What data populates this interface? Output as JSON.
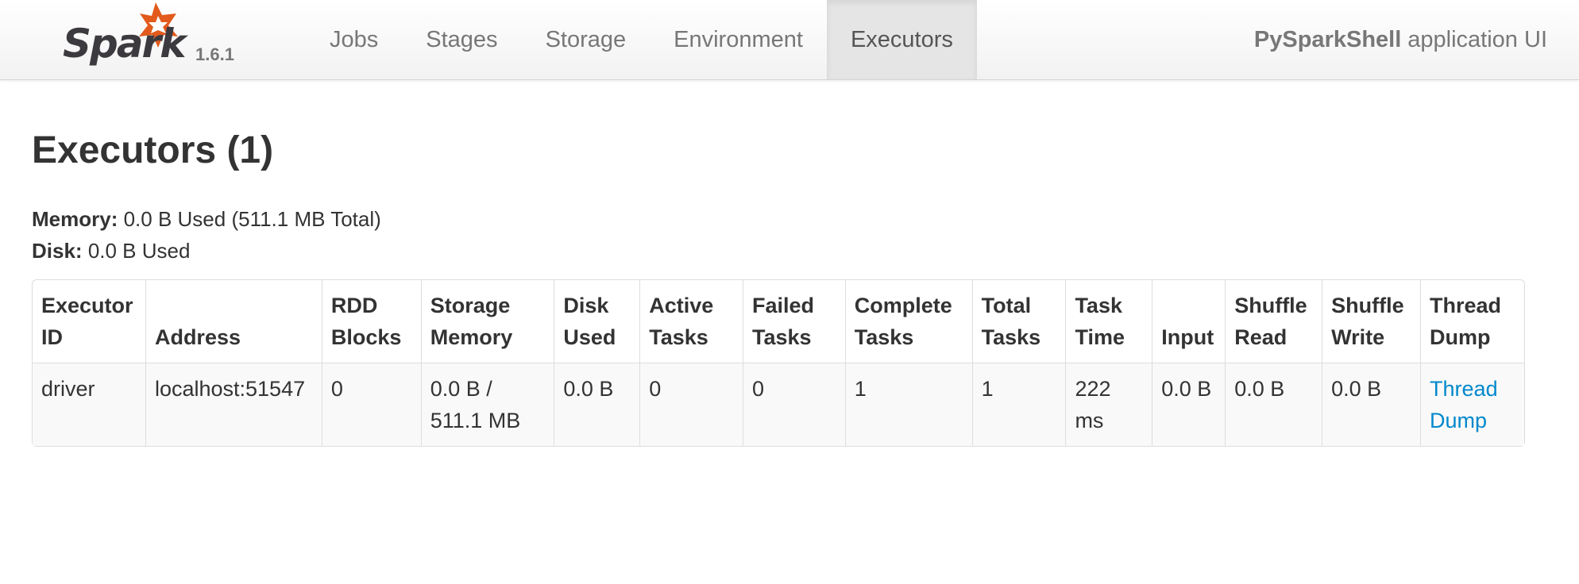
{
  "navbar": {
    "brand": "Spark",
    "version": "1.6.1",
    "tabs": [
      {
        "label": "Jobs"
      },
      {
        "label": "Stages"
      },
      {
        "label": "Storage"
      },
      {
        "label": "Environment"
      },
      {
        "label": "Executors"
      }
    ],
    "active_tab": "Executors",
    "app_name": "PySparkShell",
    "app_suffix": "application UI"
  },
  "page": {
    "title": "Executors (1)",
    "memory_label": "Memory:",
    "memory_value": "0.0 B Used (511.1 MB Total)",
    "disk_label": "Disk:",
    "disk_value": "0.0 B Used"
  },
  "table": {
    "headers": [
      "Executor ID",
      "Address",
      "RDD Blocks",
      "Storage Memory",
      "Disk Used",
      "Active Tasks",
      "Failed Tasks",
      "Complete Tasks",
      "Total Tasks",
      "Task Time",
      "Input",
      "Shuffle Read",
      "Shuffle Write",
      "Thread Dump"
    ],
    "rows": [
      {
        "executor_id": "driver",
        "address": "localhost:51547",
        "rdd_blocks": "0",
        "storage_memory": "0.0 B / 511.1 MB",
        "disk_used": "0.0 B",
        "active_tasks": "0",
        "failed_tasks": "0",
        "complete_tasks": "1",
        "total_tasks": "1",
        "task_time": "222 ms",
        "input": "0.0 B",
        "shuffle_read": "0.0 B",
        "shuffle_write": "0.0 B",
        "thread_dump": "Thread Dump"
      }
    ]
  },
  "colors": {
    "logo_star": "#e25a1c",
    "logo_text": "#3c3a3e",
    "link": "#0088cc",
    "active_tab_bg": "#e5e5e5"
  }
}
